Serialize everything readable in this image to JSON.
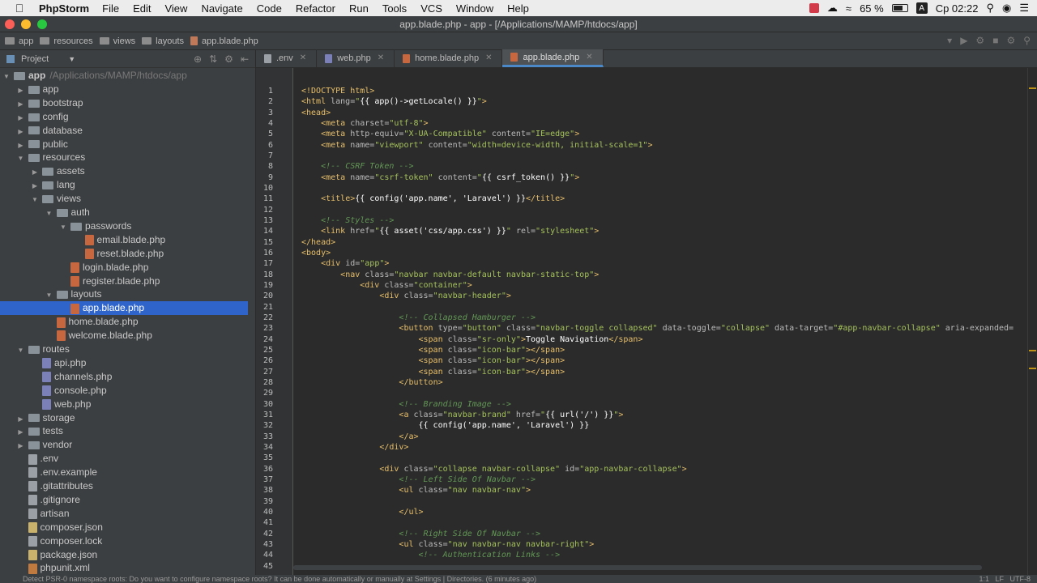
{
  "menubar": {
    "app_name": "PhpStorm",
    "items": [
      "File",
      "Edit",
      "View",
      "Navigate",
      "Code",
      "Refactor",
      "Run",
      "Tools",
      "VCS",
      "Window",
      "Help"
    ],
    "battery": "65 %",
    "input_source": "A",
    "clock": "Ср 02:22"
  },
  "window": {
    "title": "app.blade.php - app - [/Applications/MAMP/htdocs/app]"
  },
  "breadcrumbs": [
    "app",
    "resources",
    "views",
    "layouts",
    "app.blade.php"
  ],
  "project_panel": {
    "title": "Project",
    "tree": [
      {
        "label": "app",
        "path": "/Applications/MAMP/htdocs/app",
        "depth": 0,
        "type": "folder",
        "expanded": true
      },
      {
        "label": "app",
        "depth": 1,
        "type": "folder",
        "expanded": false
      },
      {
        "label": "bootstrap",
        "depth": 1,
        "type": "folder",
        "expanded": false
      },
      {
        "label": "config",
        "depth": 1,
        "type": "folder",
        "expanded": false
      },
      {
        "label": "database",
        "depth": 1,
        "type": "folder",
        "expanded": false
      },
      {
        "label": "public",
        "depth": 1,
        "type": "folder",
        "expanded": false
      },
      {
        "label": "resources",
        "depth": 1,
        "type": "folder",
        "expanded": true
      },
      {
        "label": "assets",
        "depth": 2,
        "type": "folder",
        "expanded": false
      },
      {
        "label": "lang",
        "depth": 2,
        "type": "folder",
        "expanded": false
      },
      {
        "label": "views",
        "depth": 2,
        "type": "folder",
        "expanded": true
      },
      {
        "label": "auth",
        "depth": 3,
        "type": "folder",
        "expanded": true
      },
      {
        "label": "passwords",
        "depth": 4,
        "type": "folder",
        "expanded": true
      },
      {
        "label": "email.blade.php",
        "depth": 5,
        "type": "blade"
      },
      {
        "label": "reset.blade.php",
        "depth": 5,
        "type": "blade"
      },
      {
        "label": "login.blade.php",
        "depth": 4,
        "type": "blade"
      },
      {
        "label": "register.blade.php",
        "depth": 4,
        "type": "blade"
      },
      {
        "label": "layouts",
        "depth": 3,
        "type": "folder",
        "expanded": true
      },
      {
        "label": "app.blade.php",
        "depth": 4,
        "type": "blade",
        "selected": true
      },
      {
        "label": "home.blade.php",
        "depth": 3,
        "type": "blade"
      },
      {
        "label": "welcome.blade.php",
        "depth": 3,
        "type": "blade"
      },
      {
        "label": "routes",
        "depth": 1,
        "type": "folder",
        "expanded": true
      },
      {
        "label": "api.php",
        "depth": 2,
        "type": "php"
      },
      {
        "label": "channels.php",
        "depth": 2,
        "type": "php"
      },
      {
        "label": "console.php",
        "depth": 2,
        "type": "php"
      },
      {
        "label": "web.php",
        "depth": 2,
        "type": "php"
      },
      {
        "label": "storage",
        "depth": 1,
        "type": "folder",
        "expanded": false
      },
      {
        "label": "tests",
        "depth": 1,
        "type": "folder",
        "expanded": false
      },
      {
        "label": "vendor",
        "depth": 1,
        "type": "folder",
        "expanded": false
      },
      {
        "label": ".env",
        "depth": 1,
        "type": "file"
      },
      {
        "label": ".env.example",
        "depth": 1,
        "type": "file"
      },
      {
        "label": ".gitattributes",
        "depth": 1,
        "type": "file"
      },
      {
        "label": ".gitignore",
        "depth": 1,
        "type": "file"
      },
      {
        "label": "artisan",
        "depth": 1,
        "type": "file"
      },
      {
        "label": "composer.json",
        "depth": 1,
        "type": "json"
      },
      {
        "label": "composer.lock",
        "depth": 1,
        "type": "file"
      },
      {
        "label": "package.json",
        "depth": 1,
        "type": "json"
      },
      {
        "label": "phpunit.xml",
        "depth": 1,
        "type": "xml"
      }
    ]
  },
  "tabs": [
    {
      "label": ".env",
      "color": "#9aa0a6",
      "active": false
    },
    {
      "label": "web.php",
      "color": "#7c80b9",
      "active": false
    },
    {
      "label": "home.blade.php",
      "color": "#c6673f",
      "active": false
    },
    {
      "label": "app.blade.php",
      "color": "#c6673f",
      "active": true
    }
  ],
  "editor": {
    "lines": [
      {
        "n": 1,
        "html": "<span class=\"t\">&lt;!DOCTYPE html&gt;</span>"
      },
      {
        "n": 2,
        "html": "<span class=\"t\">&lt;html </span><span class=\"a\">lang=</span><span class=\"s\">\"</span><span class=\"p\">{{ app()-&gt;getLocale() }}</span><span class=\"s\">\"</span><span class=\"t\">&gt;</span>"
      },
      {
        "n": 3,
        "html": "<span class=\"t\">&lt;head&gt;</span>"
      },
      {
        "n": 4,
        "html": "    <span class=\"t\">&lt;meta </span><span class=\"a\">charset=</span><span class=\"s\">\"utf-8\"</span><span class=\"t\">&gt;</span>"
      },
      {
        "n": 5,
        "html": "    <span class=\"t\">&lt;meta </span><span class=\"a\">http-equiv=</span><span class=\"s\">\"X-UA-Compatible\" </span><span class=\"a\">content=</span><span class=\"s\">\"IE=edge\"</span><span class=\"t\">&gt;</span>"
      },
      {
        "n": 6,
        "html": "    <span class=\"t\">&lt;meta </span><span class=\"a\">name=</span><span class=\"s\">\"viewport\" </span><span class=\"a\">content=</span><span class=\"s\">\"width=device-width, initial-scale=1\"</span><span class=\"t\">&gt;</span>"
      },
      {
        "n": 7,
        "html": ""
      },
      {
        "n": 8,
        "html": "    <span class=\"c\">&lt;!-- CSRF Token --&gt;</span>"
      },
      {
        "n": 9,
        "html": "    <span class=\"t\">&lt;meta </span><span class=\"a\">name=</span><span class=\"s\">\"csrf-token\" </span><span class=\"a\">content=</span><span class=\"s\">\"</span><span class=\"p\">{{ csrf_token() }}</span><span class=\"s\">\"</span><span class=\"t\">&gt;</span>"
      },
      {
        "n": 10,
        "html": ""
      },
      {
        "n": 11,
        "html": "    <span class=\"t\">&lt;title&gt;</span><span class=\"p\">{{ config('app.name', 'Laravel') }}</span><span class=\"t\">&lt;/title&gt;</span>"
      },
      {
        "n": 12,
        "html": ""
      },
      {
        "n": 13,
        "html": "    <span class=\"c\">&lt;!-- Styles --&gt;</span>"
      },
      {
        "n": 14,
        "html": "    <span class=\"t\">&lt;link </span><span class=\"a\">href=</span><span class=\"s\">\"</span><span class=\"p\">{{ asset('css/app.css') }}</span><span class=\"s\">\" </span><span class=\"a\">rel=</span><span class=\"s\">\"stylesheet\"</span><span class=\"t\">&gt;</span>"
      },
      {
        "n": 15,
        "html": "<span class=\"t\">&lt;/head&gt;</span>"
      },
      {
        "n": 16,
        "html": "<span class=\"t\">&lt;body&gt;</span>"
      },
      {
        "n": 17,
        "html": "    <span class=\"t\">&lt;div </span><span class=\"a\">id=</span><span class=\"s\">\"app\"</span><span class=\"t\">&gt;</span>"
      },
      {
        "n": 18,
        "html": "        <span class=\"t\">&lt;nav </span><span class=\"a\">class=</span><span class=\"s\">\"navbar navbar-default navbar-static-top\"</span><span class=\"t\">&gt;</span>"
      },
      {
        "n": 19,
        "html": "            <span class=\"t\">&lt;div </span><span class=\"a\">class=</span><span class=\"s\">\"container\"</span><span class=\"t\">&gt;</span>"
      },
      {
        "n": 20,
        "html": "                <span class=\"t\">&lt;div </span><span class=\"a\">class=</span><span class=\"s\">\"navbar-header\"</span><span class=\"t\">&gt;</span>"
      },
      {
        "n": 21,
        "html": ""
      },
      {
        "n": 22,
        "html": "                    <span class=\"c\">&lt;!-- Collapsed Hamburger --&gt;</span>"
      },
      {
        "n": 23,
        "html": "                    <span class=\"t\">&lt;button </span><span class=\"a\">type=</span><span class=\"s\">\"button\" </span><span class=\"a\">class=</span><span class=\"s\">\"navbar-toggle collapsed\" </span><span class=\"a\">data-toggle=</span><span class=\"s\">\"collapse\" </span><span class=\"a\">data-target=</span><span class=\"s\">\"#app-navbar-collapse\" </span><span class=\"a\">aria-expanded=</span>"
      },
      {
        "n": 24,
        "html": "                        <span class=\"t\">&lt;span </span><span class=\"a\">class=</span><span class=\"s\">\"sr-only\"</span><span class=\"t\">&gt;</span><span class=\"p\">Toggle Navigation</span><span class=\"t\">&lt;/span&gt;</span>"
      },
      {
        "n": 25,
        "html": "                        <span class=\"t\">&lt;span </span><span class=\"a\">class=</span><span class=\"s\">\"icon-bar\"</span><span class=\"t\">&gt;&lt;/span&gt;</span>"
      },
      {
        "n": 26,
        "html": "                        <span class=\"t\">&lt;span </span><span class=\"a\">class=</span><span class=\"s\">\"icon-bar\"</span><span class=\"t\">&gt;&lt;/span&gt;</span>"
      },
      {
        "n": 27,
        "html": "                        <span class=\"t\">&lt;span </span><span class=\"a\">class=</span><span class=\"s\">\"icon-bar\"</span><span class=\"t\">&gt;&lt;/span&gt;</span>"
      },
      {
        "n": 28,
        "html": "                    <span class=\"t\">&lt;/button&gt;</span>"
      },
      {
        "n": 29,
        "html": ""
      },
      {
        "n": 30,
        "html": "                    <span class=\"c\">&lt;!-- Branding Image --&gt;</span>"
      },
      {
        "n": 31,
        "html": "                    <span class=\"t\">&lt;a </span><span class=\"a\">class=</span><span class=\"s\">\"navbar-brand\" </span><span class=\"a\">href=</span><span class=\"s\">\"</span><span class=\"p\">{{ url('/') }}</span><span class=\"s\">\"</span><span class=\"t\">&gt;</span>"
      },
      {
        "n": 32,
        "html": "                        <span class=\"p\">{{ config('app.name', 'Laravel') }}</span>"
      },
      {
        "n": 33,
        "html": "                    <span class=\"t\">&lt;/a&gt;</span>"
      },
      {
        "n": 34,
        "html": "                <span class=\"t\">&lt;/div&gt;</span>"
      },
      {
        "n": 35,
        "html": ""
      },
      {
        "n": 36,
        "html": "                <span class=\"t\">&lt;div </span><span class=\"a\">class=</span><span class=\"s\">\"collapse navbar-collapse\" </span><span class=\"a\">id=</span><span class=\"s\">\"app-navbar-collapse\"</span><span class=\"t\">&gt;</span>"
      },
      {
        "n": 37,
        "html": "                    <span class=\"c\">&lt;!-- Left Side Of Navbar --&gt;</span>"
      },
      {
        "n": 38,
        "html": "                    <span class=\"t\">&lt;ul </span><span class=\"a\">class=</span><span class=\"s\">\"nav navbar-nav\"</span><span class=\"t\">&gt;</span>"
      },
      {
        "n": 39,
        "html": "                        "
      },
      {
        "n": 40,
        "html": "                    <span class=\"t\">&lt;/ul&gt;</span>"
      },
      {
        "n": 41,
        "html": ""
      },
      {
        "n": 42,
        "html": "                    <span class=\"c\">&lt;!-- Right Side Of Navbar --&gt;</span>"
      },
      {
        "n": 43,
        "html": "                    <span class=\"t\">&lt;ul </span><span class=\"a\">class=</span><span class=\"s\">\"nav navbar-nav navbar-right\"</span><span class=\"t\">&gt;</span>"
      },
      {
        "n": 44,
        "html": "                        <span class=\"c\">&lt;!-- Authentication Links --&gt;</span>"
      },
      {
        "n": 45,
        "html": ""
      }
    ]
  },
  "status": {
    "message": "Detect PSR-0 namespace roots: Do you want to configure namespace roots? It can be done automatically or manually at Settings | Directories. (6 minutes ago)",
    "position": "1:1",
    "line_sep": "LF",
    "encoding": "UTF-8"
  }
}
